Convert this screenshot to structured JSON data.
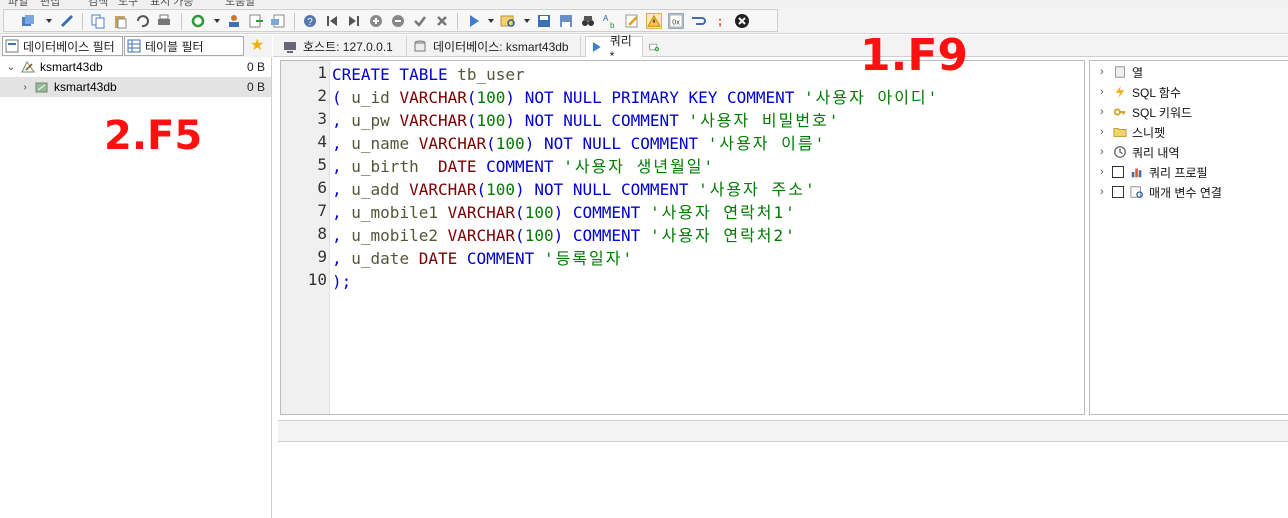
{
  "filters": {
    "database_filter": "데이터베이스 필터",
    "table_filter": "테이블 필터"
  },
  "tree": [
    {
      "name": "ksmart43db",
      "size": "0 B",
      "expanded": true
    },
    {
      "name": "ksmart43db",
      "size": "0 B",
      "expanded": false
    }
  ],
  "tabs": {
    "host": "호스트: 127.0.0.1",
    "database": "데이터베이스: ksmart43db",
    "query": "쿼리*"
  },
  "editor": {
    "line_numbers": [
      "1",
      "2",
      "3",
      "4",
      "5",
      "6",
      "7",
      "8",
      "9",
      "10"
    ],
    "lines": [
      {
        "a": "CREATE TABLE",
        "b": " tb_user"
      },
      {
        "p": "(",
        "id": " u_id ",
        "ty": "VARCHAR",
        "n1": "(",
        "num": "100",
        "n2": ")",
        "kw": " NOT NULL PRIMARY KEY COMMENT ",
        "str": "'사용자 아이디'"
      },
      {
        "p": ",",
        "id": " u_pw ",
        "ty": "VARCHAR",
        "n1": "(",
        "num": "100",
        "n2": ")",
        "kw": " NOT NULL COMMENT ",
        "str": "'사용자 비밀번호'"
      },
      {
        "p": ",",
        "id": " u_name ",
        "ty": "VARCHAR",
        "n1": "(",
        "num": "100",
        "n2": ")",
        "kw": " NOT NULL COMMENT ",
        "str": "'사용자 이름'"
      },
      {
        "p": ",",
        "id": " u_birth  ",
        "ty": "DATE",
        "kw": " COMMENT ",
        "str": "'사용자 생년월일'"
      },
      {
        "p": ",",
        "id": " u_add ",
        "ty": "VARCHAR",
        "n1": "(",
        "num": "100",
        "n2": ")",
        "kw": " NOT NULL COMMENT ",
        "str": "'사용자 주소'"
      },
      {
        "p": ",",
        "id": " u_mobile1 ",
        "ty": "VARCHAR",
        "n1": "(",
        "num": "100",
        "n2": ")",
        "kw": " COMMENT ",
        "str": "'사용자 연락처1'"
      },
      {
        "p": ",",
        "id": " u_mobile2 ",
        "ty": "VARCHAR",
        "n1": "(",
        "num": "100",
        "n2": ")",
        "kw": " COMMENT ",
        "str": "'사용자 연락처2'"
      },
      {
        "p": ",",
        "id": " u_date ",
        "ty": "DATE",
        "kw": " COMMENT ",
        "str": "'등록일자'"
      },
      {
        "p": ");"
      }
    ]
  },
  "helpers": [
    {
      "label": "열",
      "icon": "column-icon",
      "checkbox": false
    },
    {
      "label": "SQL 함수",
      "icon": "lightning-icon",
      "checkbox": false
    },
    {
      "label": "SQL 키워드",
      "icon": "key-icon",
      "checkbox": false
    },
    {
      "label": "스니펫",
      "icon": "folder-icon",
      "checkbox": false
    },
    {
      "label": "쿼리 내역",
      "icon": "history-icon",
      "checkbox": false
    },
    {
      "label": "쿼리 프로필",
      "icon": "chart-icon",
      "checkbox": true
    },
    {
      "label": "매개 변수 연결",
      "icon": "parameter-icon",
      "checkbox": true
    }
  ],
  "annotations": {
    "f9": "1.F9",
    "f5": "2.F5"
  },
  "colors": {
    "keyword": "#0000d0",
    "datatype": "#7a0000",
    "identifier": "#55553a",
    "string": "#007a00",
    "annotation": "#ff1010"
  }
}
